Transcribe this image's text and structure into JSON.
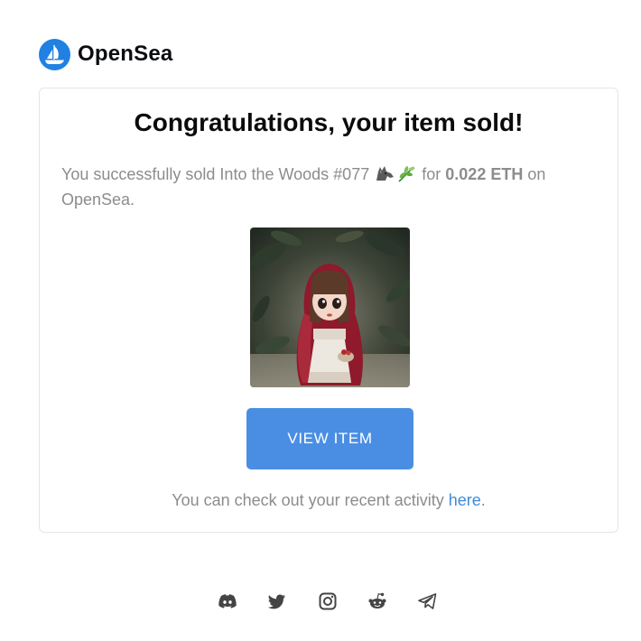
{
  "brand": {
    "name": "OpenSea",
    "logo_icon": "opensea-boat-icon",
    "accent_color": "#2081e2"
  },
  "email": {
    "headline": "Congratulations, your item sold!",
    "message_prefix": "You successfully sold Into the Woods #077",
    "message_emojis": [
      "wolf-emoji",
      "herb-emoji"
    ],
    "message_for": "for",
    "price": "0.022 ETH",
    "message_suffix": "on OpenSea.",
    "item_image_icon": "nft-doll-image",
    "view_button_label": "VIEW ITEM",
    "button_color": "#4a8ee4",
    "activity_text": "You can check out your recent activity",
    "activity_link": "here",
    "activity_end": "."
  },
  "footer": {
    "social_icons": [
      "discord-icon",
      "twitter-icon",
      "instagram-icon",
      "reddit-icon",
      "telegram-icon"
    ]
  }
}
